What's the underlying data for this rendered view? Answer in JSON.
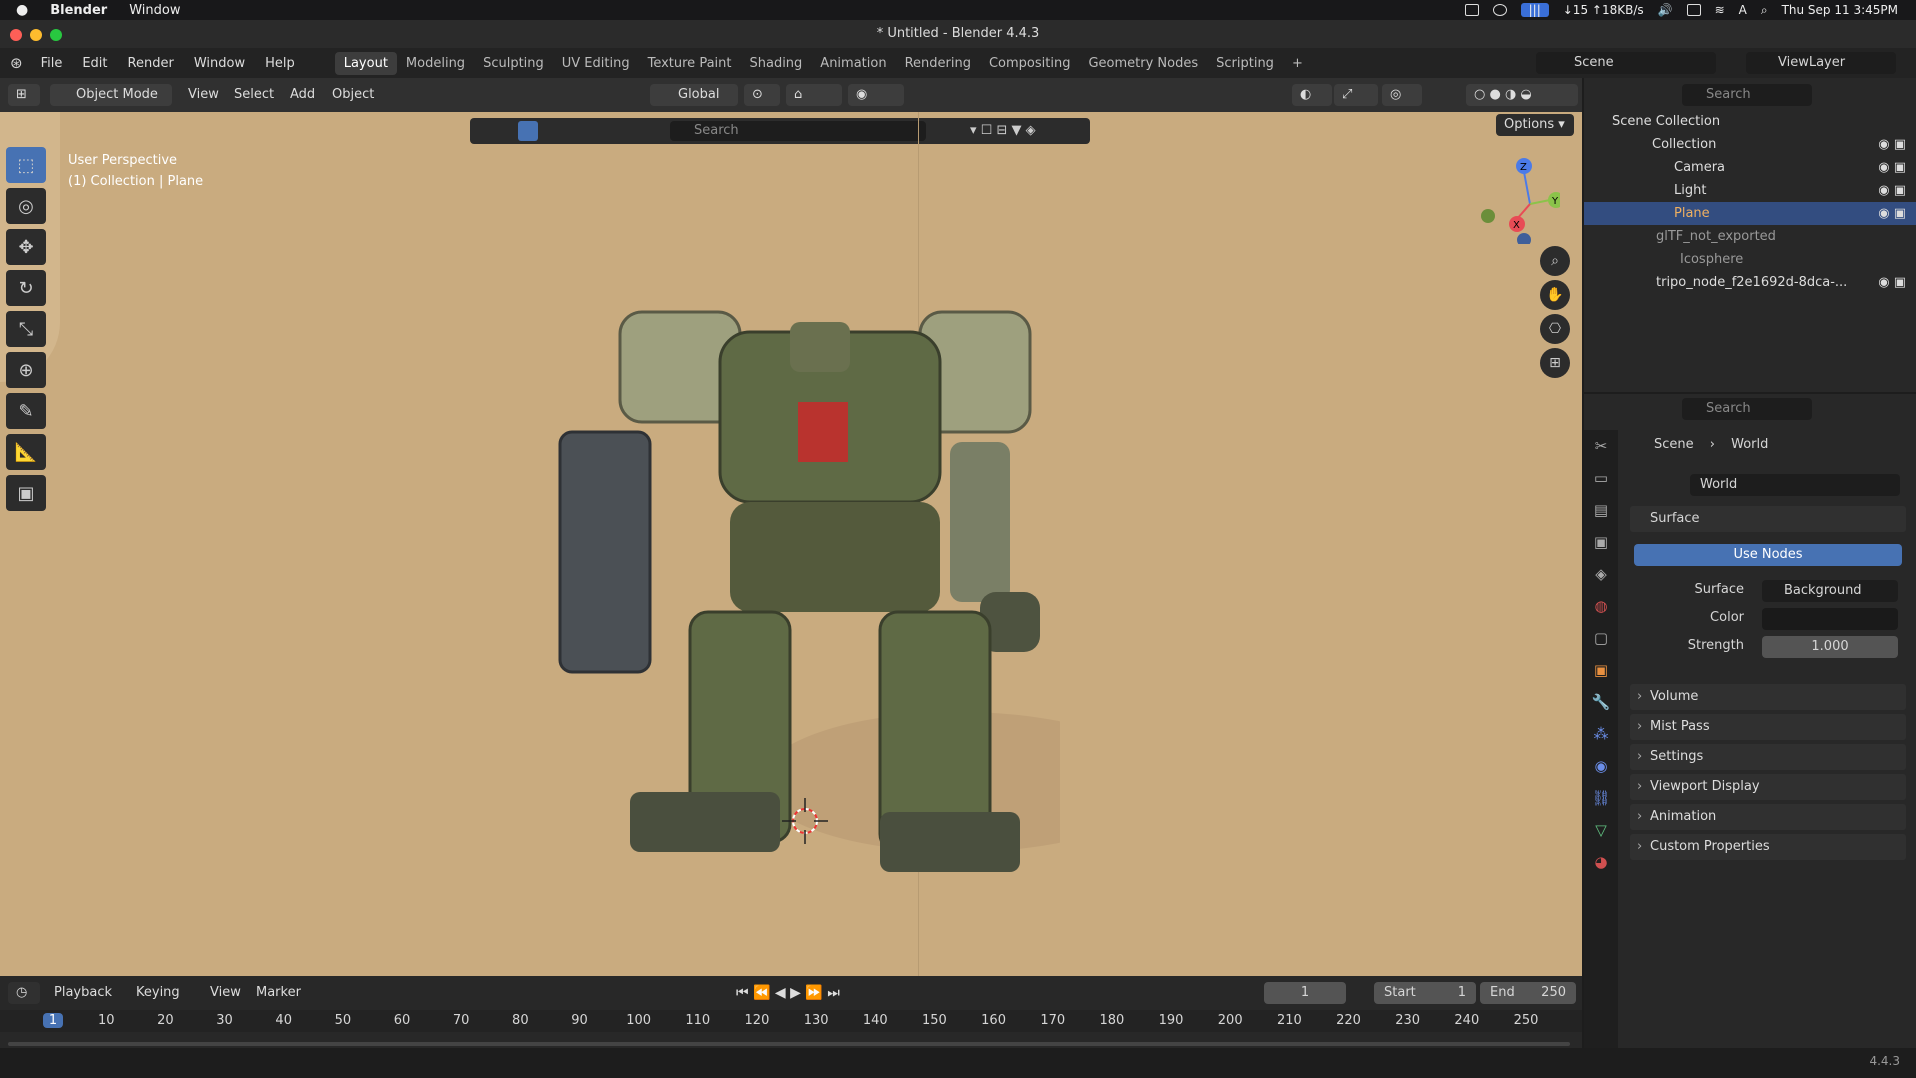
{
  "macbar": {
    "app": "Blender",
    "window": "Window",
    "net": "↓15 ↑18KB/s",
    "datetime": "Thu Sep 11  3:45PM"
  },
  "title": "* Untitled - Blender 4.4.3",
  "menu": [
    "File",
    "Edit",
    "Render",
    "Window",
    "Help"
  ],
  "workspaces": [
    "Layout",
    "Modeling",
    "Sculpting",
    "UV Editing",
    "Texture Paint",
    "Shading",
    "Animation",
    "Rendering",
    "Compositing",
    "Geometry Nodes",
    "Scripting"
  ],
  "scene": {
    "label": "Scene",
    "view_layer": "ViewLayer"
  },
  "vpheader": {
    "mode": "Object Mode",
    "menus": [
      "View",
      "Select",
      "Add",
      "Object"
    ],
    "orientation": "Global",
    "search_placeholder": "Search",
    "options": "Options"
  },
  "viewport": {
    "perspective": "User Perspective",
    "context": "(1) Collection | Plane"
  },
  "outliner": {
    "search_placeholder": "Search",
    "root": "Scene Collection",
    "rows": [
      {
        "label": "Collection"
      },
      {
        "label": "Camera"
      },
      {
        "label": "Light"
      },
      {
        "label": "Plane"
      },
      {
        "label": "glTF_not_exported"
      },
      {
        "label": "Icosphere"
      },
      {
        "label": "tripo_node_f2e1692d-8dca-..."
      }
    ]
  },
  "properties": {
    "search_placeholder": "Search",
    "breadcrumb_scene": "Scene",
    "breadcrumb_world": "World",
    "world_name": "World",
    "surface_header": "Surface",
    "use_nodes": "Use Nodes",
    "surface_label": "Surface",
    "surface_value": "Background",
    "color_label": "Color",
    "strength_label": "Strength",
    "strength_value": "1.000",
    "sections": [
      "Volume",
      "Mist Pass",
      "Settings",
      "Viewport Display",
      "Animation",
      "Custom Properties"
    ]
  },
  "timeline": {
    "menus": [
      "Playback",
      "Keying",
      "View",
      "Marker"
    ],
    "current_frame": "1",
    "start_label": "Start",
    "start_value": "1",
    "end_label": "End",
    "end_value": "250",
    "ticks": [
      "1",
      "10",
      "20",
      "30",
      "40",
      "50",
      "60",
      "70",
      "80",
      "90",
      "100",
      "110",
      "120",
      "130",
      "140",
      "150",
      "160",
      "170",
      "180",
      "190",
      "200",
      "210",
      "220",
      "230",
      "240",
      "250"
    ]
  },
  "status": {
    "version": "4.4.3"
  }
}
